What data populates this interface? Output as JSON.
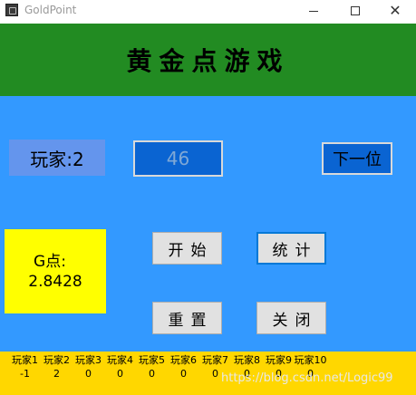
{
  "window": {
    "title": "GoldPoint",
    "minimize_glyph": "",
    "close_glyph": "✕"
  },
  "header": {
    "title": "黄金点游戏"
  },
  "controls": {
    "player_label": "玩家:2",
    "number_input_value": "46",
    "next_button": "下一位",
    "gpoint_label": "G点:",
    "gpoint_value": "2.8428",
    "start_button": "开始",
    "stats_button": "统计",
    "reset_button": "重置",
    "close_button": "关闭"
  },
  "scores": {
    "players": [
      {
        "name": "玩家1",
        "score": "-1"
      },
      {
        "name": "玩家2",
        "score": "2"
      },
      {
        "name": "玩家3",
        "score": "0"
      },
      {
        "name": "玩家4",
        "score": "0"
      },
      {
        "name": "玩家5",
        "score": "0"
      },
      {
        "name": "玩家6",
        "score": "0"
      },
      {
        "name": "玩家7",
        "score": "0"
      },
      {
        "name": "玩家8",
        "score": "0"
      },
      {
        "name": "玩家9",
        "score": "0"
      },
      {
        "name": "玩家10",
        "score": "0"
      }
    ]
  },
  "watermark": "https://blog.csdn.net/Logic99",
  "colors": {
    "header_bg": "#228b22",
    "main_bg": "#3399ff",
    "player_label_bg": "#6495ed",
    "input_bg": "#0a64d2",
    "gpoint_bg": "#ffff00",
    "scorebar_bg": "#ffd700"
  },
  "icons": {
    "app": "app-icon",
    "minimize": "minimize-icon",
    "maximize": "maximize-icon",
    "close": "close-icon"
  }
}
